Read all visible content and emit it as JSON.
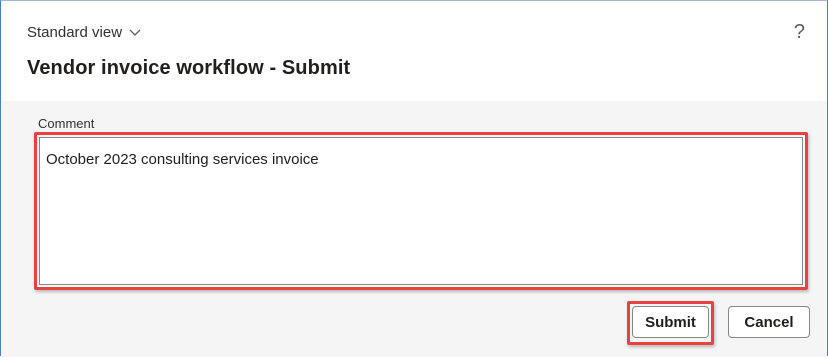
{
  "header": {
    "view_label": "Standard view",
    "help_symbol": "?",
    "title": "Vendor invoice workflow - Submit"
  },
  "form": {
    "comment_label": "Comment",
    "comment_value": "October 2023 consulting services invoice"
  },
  "actions": {
    "submit_label": "Submit",
    "cancel_label": "Cancel"
  },
  "colors": {
    "highlight": "#e8413f",
    "frame": "#4a7fc1",
    "body_bg": "#f5f5f5"
  },
  "icons": {
    "view_chevron": "chevron-down-icon",
    "help": "help-icon"
  }
}
